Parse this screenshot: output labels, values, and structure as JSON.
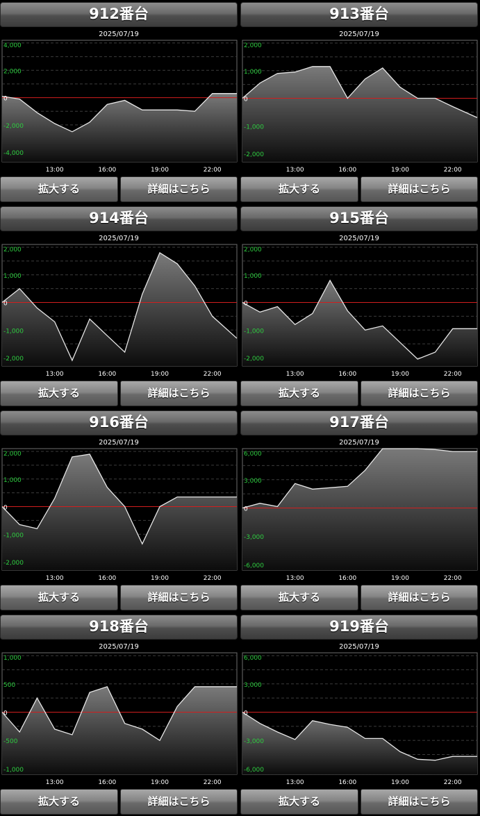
{
  "buttons": {
    "zoom": "拡大する",
    "detail": "詳細はこちら"
  },
  "colors": {
    "axis_label": "#2ecc40",
    "zero_line": "#d21e1e",
    "line": "#e6e6e6",
    "text": "#ffffff"
  },
  "machines": [
    {
      "title": "912番台",
      "date": "2025/07/19",
      "chart_data": {
        "type": "area",
        "x_ticks": [
          "13:00",
          "16:00",
          "19:00",
          "22:00"
        ],
        "y_ticks": [
          "4,000",
          "2,000",
          "0",
          "-2,000",
          "-4,000"
        ],
        "y_tick_values": [
          4000,
          2000,
          0,
          -2000,
          -4000
        ],
        "ylim": [
          -4700,
          4200
        ],
        "xlim": [
          10,
          23.4
        ],
        "x": [
          10,
          11,
          12,
          13,
          14,
          15,
          16,
          17,
          18,
          19,
          20,
          21,
          22,
          23.4
        ],
        "y": [
          100,
          -100,
          -1100,
          -1900,
          -2500,
          -1800,
          -500,
          -200,
          -900,
          -900,
          -900,
          -1000,
          300,
          300
        ]
      }
    },
    {
      "title": "913番台",
      "date": "2025/07/19",
      "chart_data": {
        "type": "area",
        "x_ticks": [
          "13:00",
          "16:00",
          "19:00",
          "22:00"
        ],
        "y_ticks": [
          "2,000",
          "1,000",
          "0",
          "-1,000",
          "-2,000"
        ],
        "y_tick_values": [
          2000,
          1000,
          0,
          -1000,
          -2000
        ],
        "ylim": [
          -2300,
          2100
        ],
        "xlim": [
          10,
          23.4
        ],
        "x": [
          10,
          11,
          12,
          13,
          14,
          15,
          16,
          17,
          18,
          19,
          20,
          21,
          22,
          23.4
        ],
        "y": [
          0,
          550,
          900,
          950,
          1150,
          1150,
          0,
          700,
          1100,
          400,
          0,
          0,
          -300,
          -700
        ]
      }
    },
    {
      "title": "914番台",
      "date": "2025/07/19",
      "chart_data": {
        "type": "area",
        "x_ticks": [
          "13:00",
          "16:00",
          "19:00",
          "22:00"
        ],
        "y_ticks": [
          "2,000",
          "1,000",
          "0",
          "-1,000",
          "-2,000"
        ],
        "y_tick_values": [
          2000,
          1000,
          0,
          -1000,
          -2000
        ],
        "ylim": [
          -2300,
          2100
        ],
        "xlim": [
          10,
          23.4
        ],
        "x": [
          10,
          11,
          12,
          13,
          14,
          15,
          16,
          17,
          18,
          19,
          20,
          21,
          22,
          23.4
        ],
        "y": [
          0,
          500,
          -200,
          -700,
          -2100,
          -600,
          -1200,
          -1800,
          300,
          1800,
          1400,
          600,
          -500,
          -1300
        ]
      }
    },
    {
      "title": "915番台",
      "date": "2025/07/19",
      "chart_data": {
        "type": "area",
        "x_ticks": [
          "13:00",
          "16:00",
          "19:00",
          "22:00"
        ],
        "y_ticks": [
          "2,000",
          "1,000",
          "0",
          "-1,000",
          "-2,000"
        ],
        "y_tick_values": [
          2000,
          1000,
          0,
          -1000,
          -2000
        ],
        "ylim": [
          -2300,
          2100
        ],
        "xlim": [
          10,
          23.4
        ],
        "x": [
          10,
          11,
          12,
          13,
          14,
          15,
          16,
          17,
          18,
          19,
          20,
          21,
          22,
          23.4
        ],
        "y": [
          0,
          -350,
          -150,
          -800,
          -400,
          800,
          -300,
          -1000,
          -850,
          -1450,
          -2050,
          -1800,
          -950,
          -950
        ]
      }
    },
    {
      "title": "916番台",
      "date": "2025/07/19",
      "chart_data": {
        "type": "area",
        "x_ticks": [
          "13:00",
          "16:00",
          "19:00",
          "22:00"
        ],
        "y_ticks": [
          "2,000",
          "1,000",
          "0",
          "-1,000",
          "-2,000"
        ],
        "y_tick_values": [
          2000,
          1000,
          0,
          -1000,
          -2000
        ],
        "ylim": [
          -2300,
          2100
        ],
        "xlim": [
          10,
          23.4
        ],
        "x": [
          10,
          11,
          12,
          13,
          14,
          15,
          16,
          17,
          18,
          19,
          20,
          21,
          22,
          23.4
        ],
        "y": [
          0,
          -650,
          -800,
          300,
          1800,
          1900,
          700,
          0,
          -1350,
          0,
          350,
          350,
          350,
          350
        ]
      }
    },
    {
      "title": "917番台",
      "date": "2025/07/19",
      "chart_data": {
        "type": "area",
        "x_ticks": [
          "13:00",
          "16:00",
          "19:00",
          "22:00"
        ],
        "y_ticks": [
          "6,000",
          "3,000",
          "0",
          "-3,000",
          "-6,000"
        ],
        "y_tick_values": [
          6000,
          3000,
          0,
          -3000,
          -6000
        ],
        "ylim": [
          -6600,
          6300
        ],
        "xlim": [
          10,
          23.4
        ],
        "x": [
          10,
          11,
          12,
          13,
          14,
          15,
          16,
          17,
          18,
          19,
          20,
          21,
          22,
          23.4
        ],
        "y": [
          0,
          500,
          150,
          2600,
          2000,
          2150,
          2300,
          4000,
          6300,
          6300,
          6300,
          6200,
          6000,
          6000
        ]
      }
    },
    {
      "title": "918番台",
      "date": "2025/07/19",
      "chart_data": {
        "type": "area",
        "x_ticks": [
          "13:00",
          "16:00",
          "19:00",
          "22:00"
        ],
        "y_ticks": [
          "1,000",
          "500",
          "0",
          "-500",
          "-1,000"
        ],
        "y_tick_values": [
          1000,
          500,
          0,
          -500,
          -1000
        ],
        "ylim": [
          -1100,
          1050
        ],
        "xlim": [
          10,
          23.4
        ],
        "x": [
          10,
          11,
          12,
          13,
          14,
          15,
          16,
          17,
          18,
          19,
          20,
          21,
          22,
          23.4
        ],
        "y": [
          0,
          -350,
          250,
          -300,
          -400,
          350,
          450,
          -200,
          -300,
          -500,
          100,
          450,
          450,
          450
        ]
      }
    },
    {
      "title": "919番台",
      "date": "2025/07/19",
      "chart_data": {
        "type": "area",
        "x_ticks": [
          "13:00",
          "16:00",
          "19:00",
          "22:00"
        ],
        "y_ticks": [
          "6,000",
          "3,000",
          "0",
          "-3,000",
          "-6,000"
        ],
        "y_tick_values": [
          6000,
          3000,
          0,
          -3000,
          -6000
        ],
        "ylim": [
          -6600,
          6300
        ],
        "xlim": [
          10,
          23.4
        ],
        "x": [
          10,
          11,
          12,
          13,
          14,
          15,
          16,
          17,
          18,
          19,
          20,
          21,
          22,
          23.4
        ],
        "y": [
          0,
          -1200,
          -2100,
          -2900,
          -900,
          -1300,
          -1600,
          -2800,
          -2800,
          -4200,
          -5000,
          -5100,
          -4700,
          -4700
        ]
      }
    }
  ]
}
